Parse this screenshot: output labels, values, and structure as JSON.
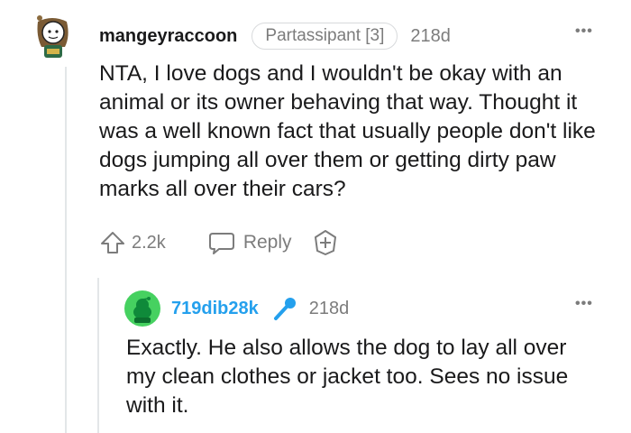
{
  "comment": {
    "username": "mangeyraccoon",
    "flair": "Partassipant [3]",
    "timestamp": "218d",
    "more_label": "•••",
    "body": "NTA, I love dogs and I wouldn't be okay with an animal or its owner behaving that way. Thought it was a well known fact that usually people don't like dogs jumping all over them or getting dirty paw marks all over their cars?",
    "votes": "2.2k",
    "reply_label": "Reply"
  },
  "reply": {
    "username": "719dib28k",
    "username_color": "#24a0ed",
    "timestamp": "218d",
    "more_label": "•••",
    "body": "Exactly. He also allows the dog to lay all over my clean clothes or jacket too. Sees no issue with it."
  },
  "icons": {
    "upvote": "upvote-icon",
    "reply": "reply-icon",
    "award": "award-icon",
    "mic": "microphone-icon",
    "avatar": "avatar"
  }
}
